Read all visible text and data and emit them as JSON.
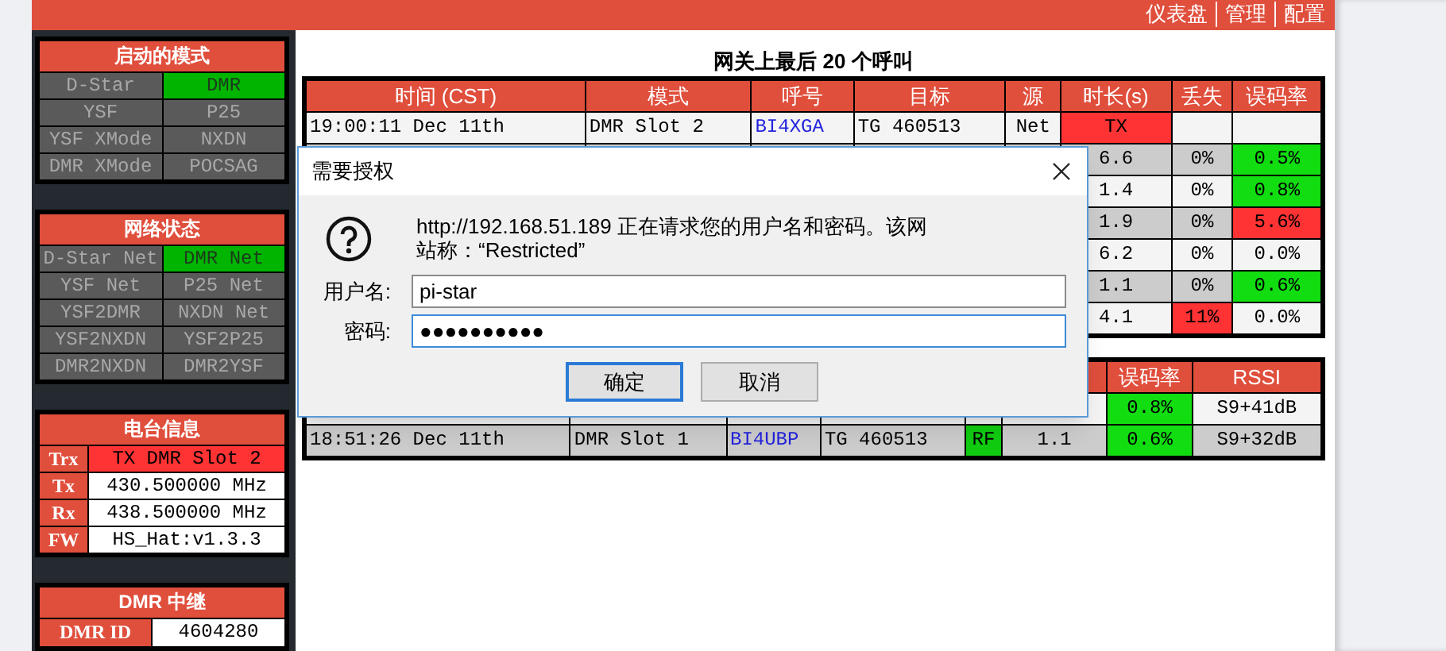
{
  "header": {
    "nav": [
      "仪表盘",
      "管理",
      "配置"
    ]
  },
  "sidebar": {
    "modes": {
      "title": "启动的模式",
      "items": [
        {
          "label": "D-Star",
          "on": false
        },
        {
          "label": "DMR",
          "on": true
        },
        {
          "label": "YSF",
          "on": false
        },
        {
          "label": "P25",
          "on": false
        },
        {
          "label": "YSF XMode",
          "on": false
        },
        {
          "label": "NXDN",
          "on": false
        },
        {
          "label": "DMR XMode",
          "on": false
        },
        {
          "label": "POCSAG",
          "on": false
        }
      ]
    },
    "network": {
      "title": "网络状态",
      "items": [
        {
          "label": "D-Star Net",
          "on": false
        },
        {
          "label": "DMR Net",
          "on": true
        },
        {
          "label": "YSF Net",
          "on": false
        },
        {
          "label": "P25 Net",
          "on": false
        },
        {
          "label": "YSF2DMR",
          "on": false
        },
        {
          "label": "NXDN Net",
          "on": false
        },
        {
          "label": "YSF2NXDN",
          "on": false
        },
        {
          "label": "YSF2P25",
          "on": false
        },
        {
          "label": "DMR2NXDN",
          "on": false
        },
        {
          "label": "DMR2YSF",
          "on": false
        }
      ]
    },
    "radio_info": {
      "title": "电台信息",
      "rows": [
        {
          "label": "Trx",
          "value": "TX DMR Slot 2",
          "transmitting": true
        },
        {
          "label": "Tx",
          "value": "430.500000 MHz",
          "transmitting": false
        },
        {
          "label": "Rx",
          "value": "438.500000 MHz",
          "transmitting": false
        },
        {
          "label": "FW",
          "value": "HS_Hat:v1.3.3",
          "transmitting": false
        }
      ]
    },
    "dmr_repeater": {
      "title": "DMR 中继",
      "rows": [
        {
          "label": "DMR ID",
          "value": "4604280"
        }
      ]
    }
  },
  "last_calls": {
    "title": "网关上最后 20 个呼叫",
    "columns": [
      "时间 (CST)",
      "模式",
      "呼号",
      "目标",
      "源",
      "时长(s)",
      "丢失",
      "误码率"
    ],
    "rows": [
      {
        "time": "19:00:11 Dec 11th",
        "mode": "DMR Slot 2",
        "callsign": "BI4XGA",
        "target": "TG 460513",
        "source": "Net",
        "duration": {
          "text": "TX",
          "color": "#ff3333"
        }
      },
      {
        "duration": {
          "text": "6.6"
        },
        "lost": {
          "text": "0%"
        },
        "ber": {
          "text": "0.5%",
          "color": "#11dd11"
        }
      },
      {
        "duration": {
          "text": "1.4"
        },
        "lost": {
          "text": "0%"
        },
        "ber": {
          "text": "0.8%",
          "color": "#11dd11"
        }
      },
      {
        "duration": {
          "text": "1.9"
        },
        "lost": {
          "text": "0%"
        },
        "ber": {
          "text": "5.6%",
          "color": "#ff3333"
        }
      },
      {
        "duration": {
          "text": "6.2"
        },
        "lost": {
          "text": "0%"
        },
        "ber": {
          "text": "0.0%"
        }
      },
      {
        "duration": {
          "text": "1.1"
        },
        "lost": {
          "text": "0%"
        },
        "ber": {
          "text": "0.6%",
          "color": "#11dd11"
        }
      },
      {
        "duration": {
          "text": "4.1"
        },
        "lost": {
          "text": "11%",
          "color": "#ff3333"
        },
        "ber": {
          "text": "0.0%"
        }
      }
    ]
  },
  "local_activity": {
    "columns": {
      "ber": "误码率",
      "rssi": "RSSI"
    },
    "rows": [
      {
        "ber": {
          "text": "0.8%",
          "color": "#11dd11"
        },
        "rssi": "S9+41dB"
      },
      {
        "time": "18:51:26 Dec 11th",
        "mode": "DMR Slot 1",
        "callsign": "BI4UBP",
        "target": "TG 460513",
        "source": {
          "text": "RF",
          "color": "#11cc11"
        },
        "duration": {
          "text": "1.1"
        },
        "ber": {
          "text": "0.6%",
          "color": "#11dd11"
        },
        "rssi": "S9+32dB"
      }
    ]
  },
  "dialog": {
    "title": "需要授权",
    "message": "http://192.168.51.189 正在请求您的用户名和密码。该网站称：“Restricted”",
    "username_label": "用户名:",
    "username": "pi-star",
    "password_label": "密码:",
    "password": "●●●●●●●●●●",
    "buttons": [
      {
        "label": "确定",
        "default": true
      },
      {
        "label": "取消",
        "default": false
      }
    ]
  }
}
